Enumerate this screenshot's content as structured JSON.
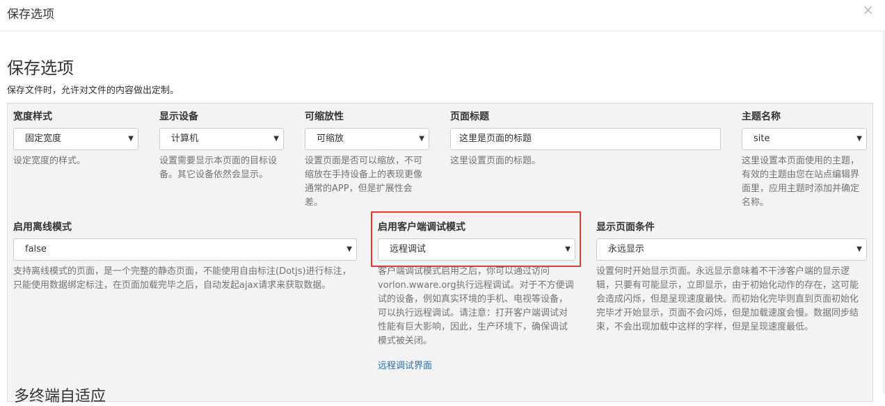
{
  "modal": {
    "title": "保存选项",
    "close_glyph": "×"
  },
  "section": {
    "title": "保存选项",
    "description": "保存文件时，允许对文件的内容做出定制。"
  },
  "fields": {
    "width_style": {
      "label": "宽度样式",
      "value": "固定宽度",
      "help": "设定宽度的样式。"
    },
    "display_device": {
      "label": "显示设备",
      "value": "计算机",
      "help": "设置需要显示本页面的目标设备。其它设备依然会显示。"
    },
    "zoomable": {
      "label": "可缩放性",
      "value": "可缩放",
      "help": "设置页面是否可以缩放，不可缩放在手持设备上的表现更像通常的APP，但是扩展性会差。"
    },
    "page_title": {
      "label": "页面标题",
      "value": "这里是页面的标题",
      "help": "这里设置页面的标题。"
    },
    "theme_name": {
      "label": "主题名称",
      "value": "site",
      "help": "这里设置本页面使用的主题，有效的主题由您在站点编辑界面里，应用主题时添加并确定名称。"
    },
    "offline_mode": {
      "label": "启用离线模式",
      "value": "false",
      "help": "支持离线模式的页面，是一个完整的静态页面，不能使用自由标注(Dotjs)进行标注，只能使用数据绑定标注，在页面加载完毕之后，自动发起ajax请求来获取数据。"
    },
    "debug_mode": {
      "label": "启用客户端调试模式",
      "value": "远程调试",
      "help": "客户端调试模式启用之后，你可以通过访问vorlon.wware.org执行远程调试。对于不方便调试的设备，例如真实环境的手机、电视等设备，可以执行远程调试。请注意：打开客户端调试对性能有巨大影响，因此，生产环境下，确保调试模式被关闭。",
      "link": "远程调试界面"
    },
    "show_condition": {
      "label": "显示页面条件",
      "value": "永远显示",
      "help": "设置何时开始显示页面。永远显示意味着不干涉客户端的显示逻辑，只要有可能显示，立即显示，由于初始化动作的存在，这可能会造成闪烁，但是呈现速度最快。而初始化完毕则直到页面初始化完毕才开始显示，页面不会闪烁，但是加载速度会慢。数据同步结束，不会出现加载中这样的字样，但是呈现速度最低。"
    }
  },
  "next_section": {
    "title": "多终端自适应"
  },
  "icons": {
    "dropdown": "▼"
  },
  "colors": {
    "highlight": "#e53935",
    "link": "#2a6fa8",
    "panel_bg": "#f3f3f3"
  }
}
